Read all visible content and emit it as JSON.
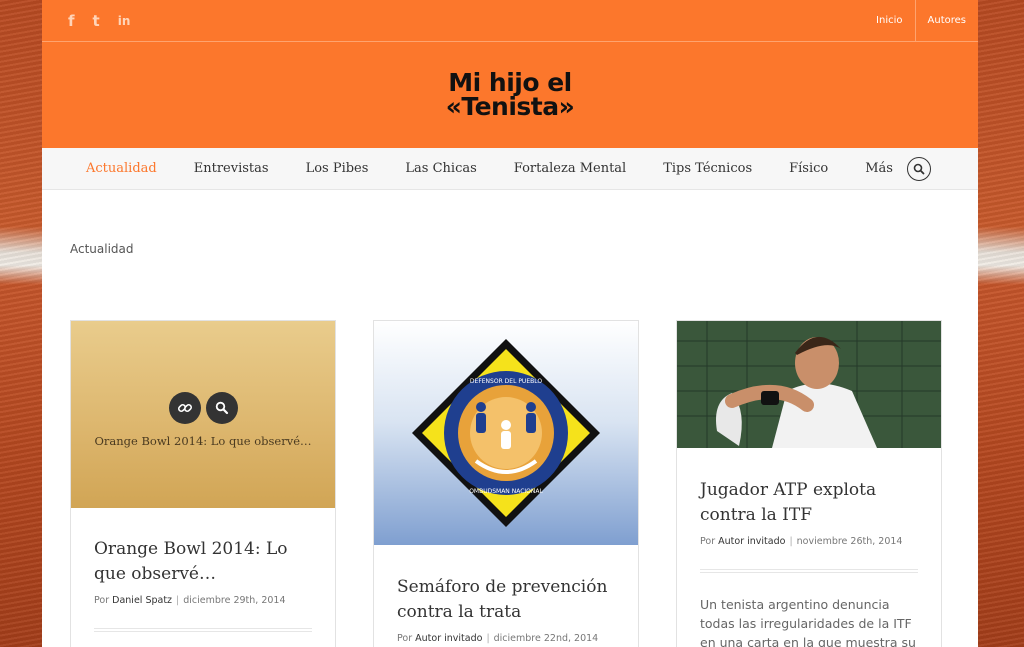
{
  "topbar": {
    "social": [
      {
        "icon": "facebook-icon",
        "glyph": "f"
      },
      {
        "icon": "twitter-icon",
        "glyph": "t"
      },
      {
        "icon": "linkedin-icon",
        "glyph": "in"
      }
    ],
    "links": [
      "Inicio",
      "Autores"
    ]
  },
  "header": {
    "logo_line1": "Mi hijo el",
    "logo_line2": "«Tenista»"
  },
  "nav": {
    "items": [
      "Actualidad",
      "Entrevistas",
      "Los Pibes",
      "Las Chicas",
      "Fortaleza Mental",
      "Tips Técnicos",
      "Físico",
      "Más"
    ],
    "active": "Actualidad"
  },
  "breadcrumb": "Actualidad",
  "posts": [
    {
      "title": "Orange Bowl 2014: Lo que observé…",
      "hover_title": "Orange Bowl 2014: Lo que observé…",
      "by": "Por",
      "author": "Daniel Spatz",
      "date": "diciembre 29th, 2014"
    },
    {
      "title": "Semáforo de prevención contra la trata",
      "by": "Por",
      "author": "Autor invitado",
      "date": "diciembre 22nd, 2014",
      "image_text_top": "DEFENSOR DEL PUEBLO",
      "image_text_side": "OMBUDSMAN NACIONAL"
    },
    {
      "title": "Jugador ATP explota contra la ITF",
      "by": "Por",
      "author": "Autor invitado",
      "date": "noviembre 26th, 2014",
      "excerpt": "Un tenista argentino denuncia todas las irregularidades de la ITF en una carta en la que muestra su"
    }
  ],
  "colors": {
    "accent": "#fc772c",
    "text": "#333333"
  }
}
